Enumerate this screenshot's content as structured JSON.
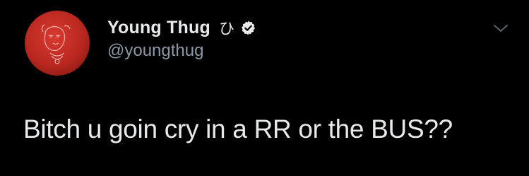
{
  "tweet": {
    "author": {
      "display_name": "Young Thug",
      "name_glyph": "ひ",
      "handle": "@youngthug",
      "verified": true,
      "avatar_icon": "avatar-red-portrait"
    },
    "menu_icon": "chevron-down-icon",
    "text": "Bitch u goin cry in a RR or the BUS??"
  },
  "colors": {
    "background": "#000000",
    "name_text": "#e7e9ea",
    "handle_text": "#8b98a5",
    "avatar_red": "#c8312b",
    "verified_badge": "#e7e9ea"
  }
}
